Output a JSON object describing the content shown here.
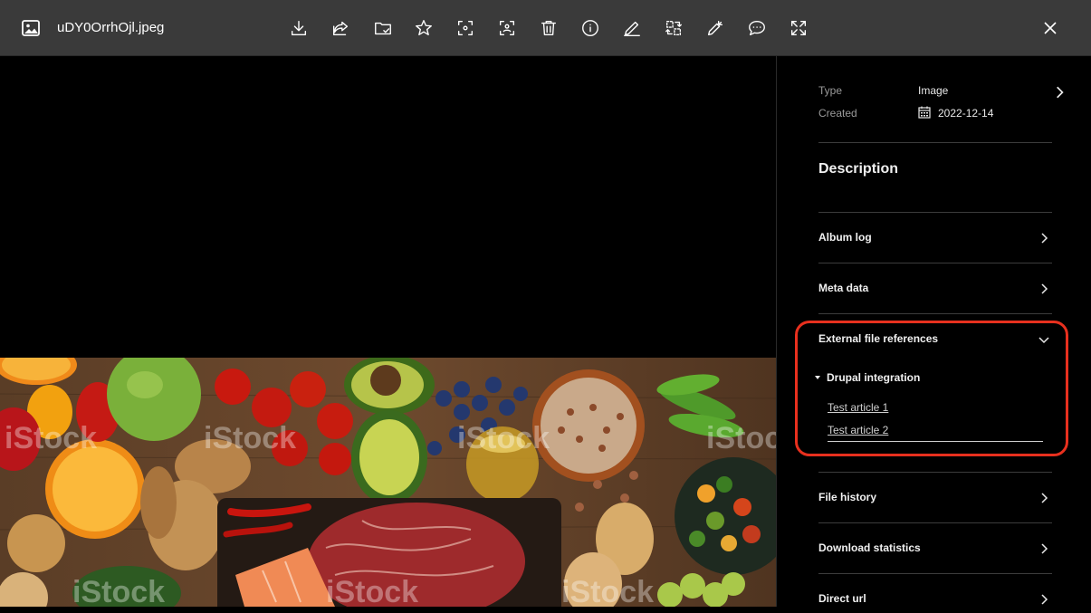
{
  "header": {
    "filename": "uDY0OrrhOjl.jpeg",
    "tools": [
      "download-icon",
      "share-icon",
      "folder-check-icon",
      "star-icon",
      "focus-icon",
      "face-detect-icon",
      "trash-icon",
      "info-icon",
      "edit-icon",
      "replace-icon",
      "magic-edit-icon",
      "comment-icon",
      "expand-icon"
    ]
  },
  "panel": {
    "type_label": "Type",
    "type_value": "Image",
    "created_label": "Created",
    "created_value": "2022-12-14",
    "description_title": "Description",
    "sections": {
      "album_log": "Album log",
      "meta_data": "Meta data",
      "external_refs": "External file references",
      "file_history": "File history",
      "download_stats": "Download statistics",
      "direct_url": "Direct url"
    },
    "drupal": {
      "label": "Drupal integration",
      "links": [
        "Test article 1",
        "Test article 2"
      ]
    }
  },
  "colors": {
    "highlight": "#e8301e",
    "topbar": "#3a3a3a"
  }
}
